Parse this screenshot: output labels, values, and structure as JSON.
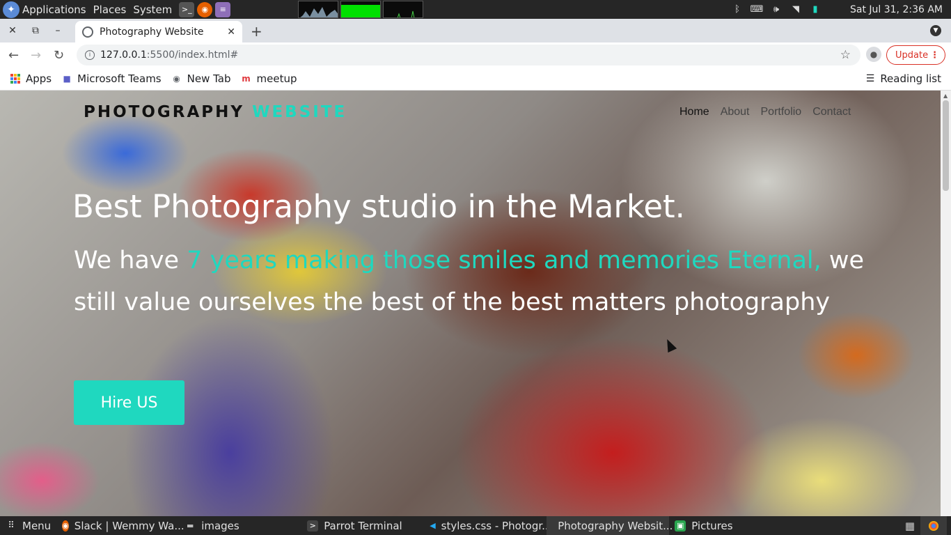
{
  "system_panel": {
    "menus": [
      "Applications",
      "Places",
      "System"
    ],
    "clock": "Sat Jul 31,  2:36 AM",
    "tray_icons": [
      "bluetooth-icon",
      "keyboard-icon",
      "volume-icon",
      "wifi-icon",
      "battery-icon"
    ]
  },
  "browser": {
    "tab_title": "Photography Website",
    "url_host": "127.0.0.1",
    "url_rest": ":5500/index.html#",
    "update_label": "Update",
    "bookmarks": [
      "Apps",
      "Microsoft Teams",
      "New Tab",
      "meetup"
    ],
    "reading_list": "Reading list"
  },
  "page": {
    "brand_main": "PHOTOGRAPHY",
    "brand_accent": "WEBSITE",
    "nav": [
      "Home",
      "About",
      "Portfolio",
      "Contact"
    ],
    "hero_title": "Best Photography studio in the Market.",
    "hero_sub_pre": "We have ",
    "hero_sub_highlight": "7 years making those smiles and memories Eternal,",
    "hero_sub_post": " we still value ourselves the best of the best matters photography",
    "cta": "Hire US",
    "accent_color": "#1fd8bf"
  },
  "taskbar": {
    "menu": "Menu",
    "tasks": [
      "Slack | Wemmy Wa...",
      "images",
      "Parrot Terminal",
      "styles.css - Photogr...",
      "Photography Websit...",
      "Pictures"
    ]
  }
}
